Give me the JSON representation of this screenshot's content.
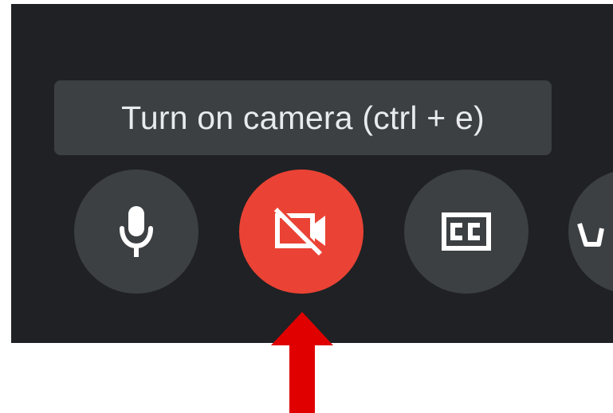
{
  "tooltip": {
    "text": "Turn on camera (ctrl + e)"
  },
  "controls": [
    {
      "name": "microphone",
      "icon": "microphone-icon",
      "state": "on"
    },
    {
      "name": "camera",
      "icon": "video-off-icon",
      "state": "off"
    },
    {
      "name": "captions",
      "icon": "closed-captions-icon",
      "state": "off"
    },
    {
      "name": "raise-hand",
      "icon": "hand-icon",
      "state": "partially-visible"
    }
  ],
  "colors": {
    "panel_background": "#202124",
    "button_background": "#3c4043",
    "camera_off_button": "#ea4335",
    "tooltip_background": "#3c4043",
    "tooltip_text": "#e8eaed",
    "annotation_arrow": "#e00000"
  },
  "annotation": {
    "type": "arrow",
    "points_to": "camera-toggle-button"
  }
}
